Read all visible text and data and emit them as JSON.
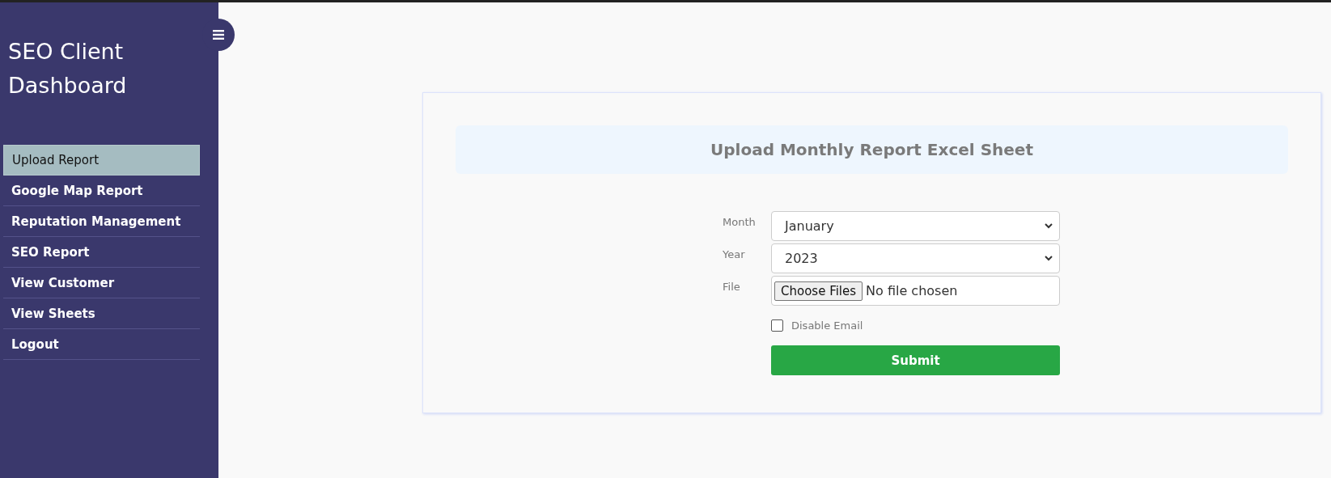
{
  "sidebar": {
    "title": "SEO Client Dashboard",
    "items": [
      {
        "label": "Upload Report",
        "selected": true
      },
      {
        "label": "Google Map Report",
        "selected": false
      },
      {
        "label": "Reputation Management",
        "selected": false
      },
      {
        "label": "SEO Report",
        "selected": false
      },
      {
        "label": "View Customer",
        "selected": false
      },
      {
        "label": "View Sheets",
        "selected": false
      },
      {
        "label": "Logout",
        "selected": false
      }
    ]
  },
  "form": {
    "heading": "Upload Monthly Report Excel Sheet",
    "fields": [
      {
        "kind": "select",
        "label": "Month",
        "value": "January"
      },
      {
        "kind": "select",
        "label": "Year",
        "value": "2023"
      },
      {
        "kind": "file",
        "label": "File",
        "button": "Choose Files",
        "value": "No file chosen"
      }
    ],
    "checkbox": {
      "label": "Disable Email",
      "checked": false
    },
    "submit": "Submit"
  }
}
